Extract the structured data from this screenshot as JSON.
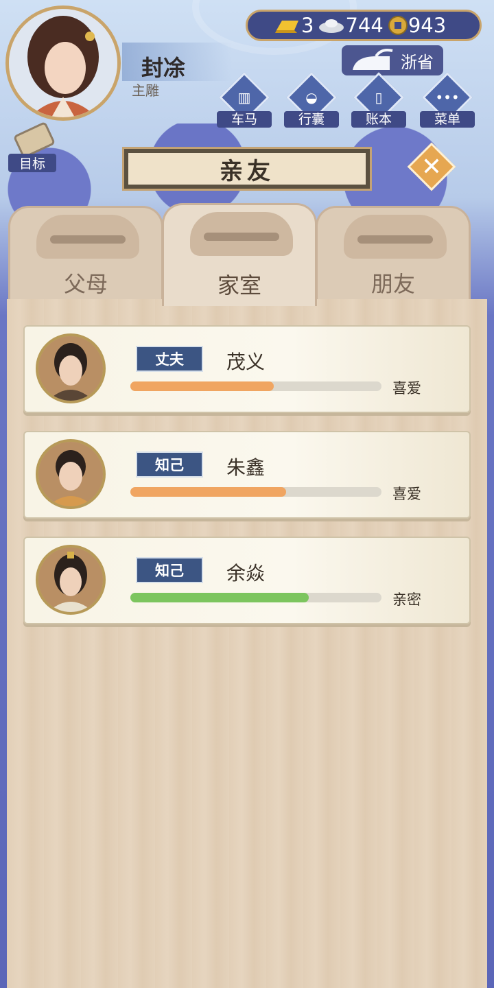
{
  "player": {
    "name": "封凃",
    "title": "主雕"
  },
  "currency": {
    "gold": "3",
    "silver": "744",
    "coin": "943"
  },
  "province": "浙省",
  "top_buttons": [
    {
      "label": "车马",
      "icon": "carriage-icon"
    },
    {
      "label": "行囊",
      "icon": "bag-icon"
    },
    {
      "label": "账本",
      "icon": "ledger-icon"
    },
    {
      "label": "菜单",
      "icon": "menu-dots-icon"
    }
  ],
  "goal_label": "目标",
  "panel_title": "亲友",
  "tabs": [
    {
      "label": "父母",
      "active": false
    },
    {
      "label": "家室",
      "active": true
    },
    {
      "label": "朋友",
      "active": false
    }
  ],
  "relations": [
    {
      "role": "丈夫",
      "name": "茂义",
      "level": "喜爱",
      "progress": 0.57,
      "bar_color": "#f0a561"
    },
    {
      "role": "知己",
      "name": "朱鑫",
      "level": "喜爱",
      "progress": 0.62,
      "bar_color": "#f0a561"
    },
    {
      "role": "知己",
      "name": "余焱",
      "level": "亲密",
      "progress": 0.71,
      "bar_color": "#7cc55e"
    }
  ],
  "colors": {
    "accent": "#3f4a86",
    "gold_border": "#c9a46a",
    "close_button": "#e6a751"
  }
}
